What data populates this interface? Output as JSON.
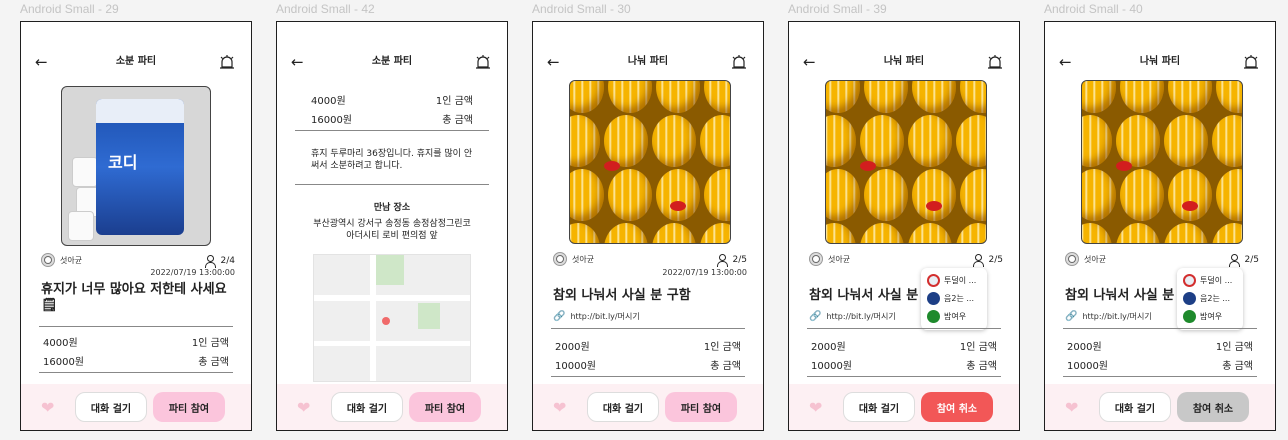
{
  "frames": [
    {
      "label": "Android Small - 29",
      "title": "소분 파티",
      "author": "섯아균",
      "count": "2/4",
      "date": "2022/07/19 13:00:00",
      "post_title": "휴지가 너무 많아요 저한테 사세요",
      "post_emoji": "🗒",
      "prices": [
        {
          "amount": "4000원",
          "label": "1인 금액"
        },
        {
          "amount": "16000원",
          "label": "총 금액"
        }
      ],
      "chat_btn": "대화 걸기",
      "action_btn": "파티 참여",
      "pack_text": "코디"
    },
    {
      "label": "Android Small - 42",
      "title": "소분 파티",
      "prices": [
        {
          "amount": "4000원",
          "label": "1인 금액"
        },
        {
          "amount": "16000원",
          "label": "총 금액"
        }
      ],
      "description": "휴지 두루마리 36장입니다. 휴지를 많이 안써서 소분하려고 합니다.",
      "place_title": "만남 장소",
      "address": "부산광역시 강서구 송정동 송정삼정그린코아더시티 로비 편의점 앞",
      "chat_btn": "대화 걸기",
      "action_btn": "파티 참여"
    },
    {
      "label": "Android Small - 30",
      "title": "나눠 파티",
      "author": "섯아균",
      "count": "2/5",
      "date": "2022/07/19 13:00:00",
      "post_title": "참외 나눠서 사실 분 구함",
      "link": "http://bit.ly/머시기",
      "prices": [
        {
          "amount": "2000원",
          "label": "1인 금액"
        },
        {
          "amount": "10000원",
          "label": "총 금액"
        }
      ],
      "chat_btn": "대화 걸기",
      "action_btn": "파티 참여"
    },
    {
      "label": "Android Small - 39",
      "title": "나눠 파티",
      "author": "섯아균",
      "count": "2/5",
      "date_partial": "202",
      "post_title": "참외 나눠서 사실 분",
      "link": "http://bit.ly/머시기",
      "prices": [
        {
          "amount": "2000원",
          "label": "1인 금액"
        },
        {
          "amount": "10000원",
          "label": "총 금액"
        }
      ],
      "members": [
        "투덜이 ...",
        "음2는 ...",
        "밤여우"
      ],
      "chat_btn": "대화 걸기",
      "action_btn": "참여 취소"
    },
    {
      "label": "Android Small - 40",
      "title": "나눠 파티",
      "author": "섯아균",
      "count": "2/5",
      "date_partial": "202",
      "post_title": "참외 나눠서 사실 분",
      "link": "http://bit.ly/머시기",
      "prices": [
        {
          "amount": "2000원",
          "label": "1인 금액"
        },
        {
          "amount": "10000원",
          "label": "총 금액"
        }
      ],
      "members": [
        "투덜이 ...",
        "음2는 ...",
        "밤여우"
      ],
      "chat_btn": "대화 걸기",
      "action_btn": "참여 취소"
    }
  ],
  "icons": {
    "back": "back-arrow-icon",
    "siren": "siren-icon",
    "heart": "heart-icon",
    "person": "person-icon",
    "link": "link-icon"
  },
  "colors": {
    "join": "#fbc5dc",
    "cancel_active": "#f25757",
    "cancel_disabled": "#c8c8c8",
    "bottom_bar": "#fdf0f3"
  }
}
